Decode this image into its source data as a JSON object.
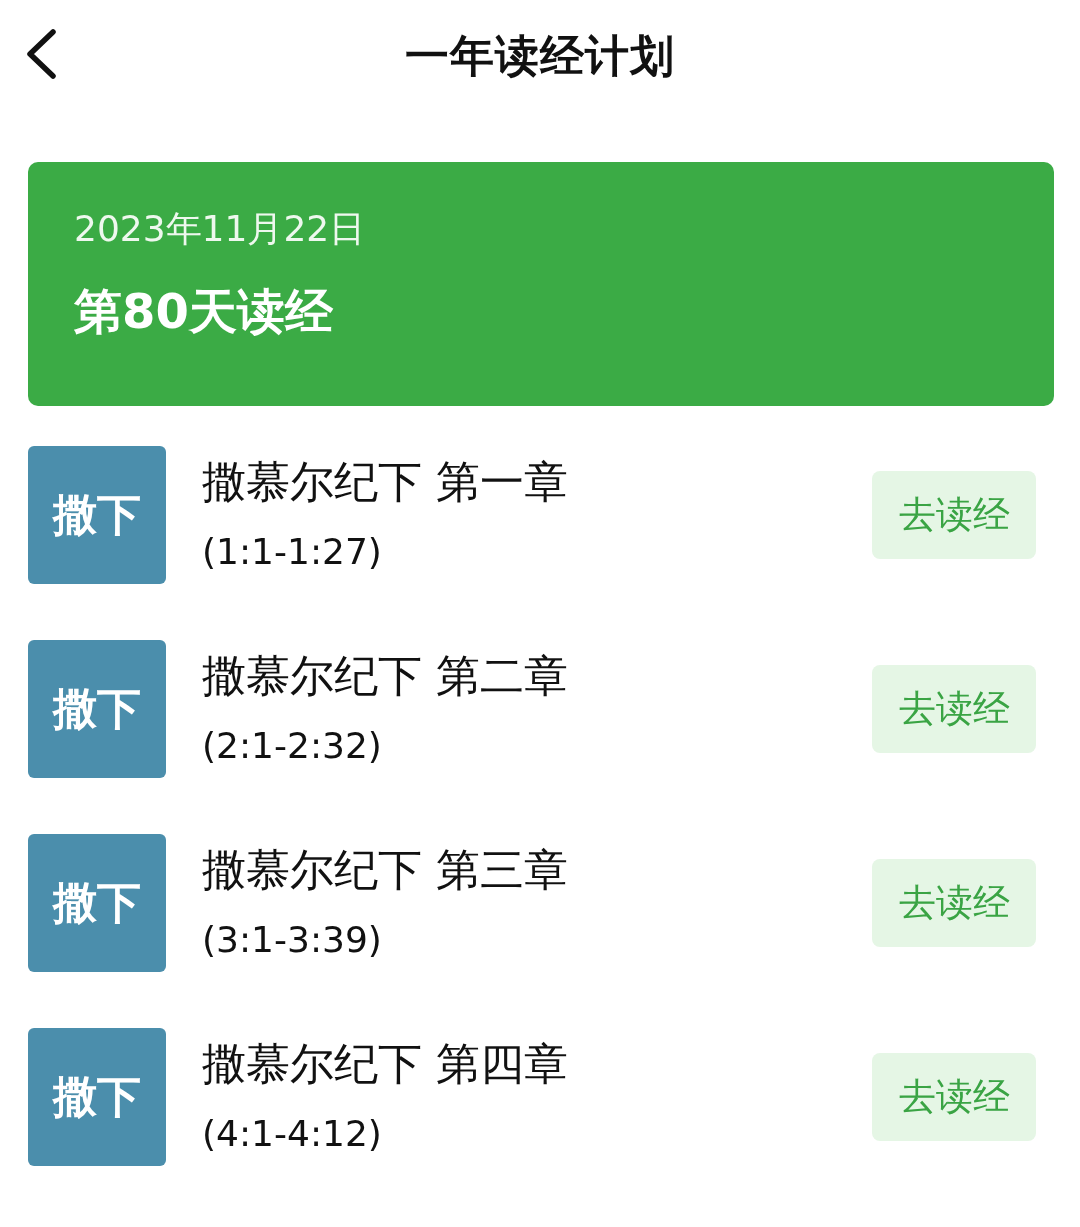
{
  "header": {
    "title": "一年读经计划"
  },
  "banner": {
    "date": "2023年11月22日",
    "day": "第80天读经"
  },
  "readings": [
    {
      "badge": "撒下",
      "title": "撒慕尔纪下 第一章",
      "range": "(1:1-1:27)",
      "action": "去读经"
    },
    {
      "badge": "撒下",
      "title": "撒慕尔纪下 第二章",
      "range": "(2:1-2:32)",
      "action": "去读经"
    },
    {
      "badge": "撒下",
      "title": "撒慕尔纪下 第三章",
      "range": "(3:1-3:39)",
      "action": "去读经"
    },
    {
      "badge": "撒下",
      "title": "撒慕尔纪下 第四章",
      "range": "(4:1-4:12)",
      "action": "去读经"
    }
  ]
}
